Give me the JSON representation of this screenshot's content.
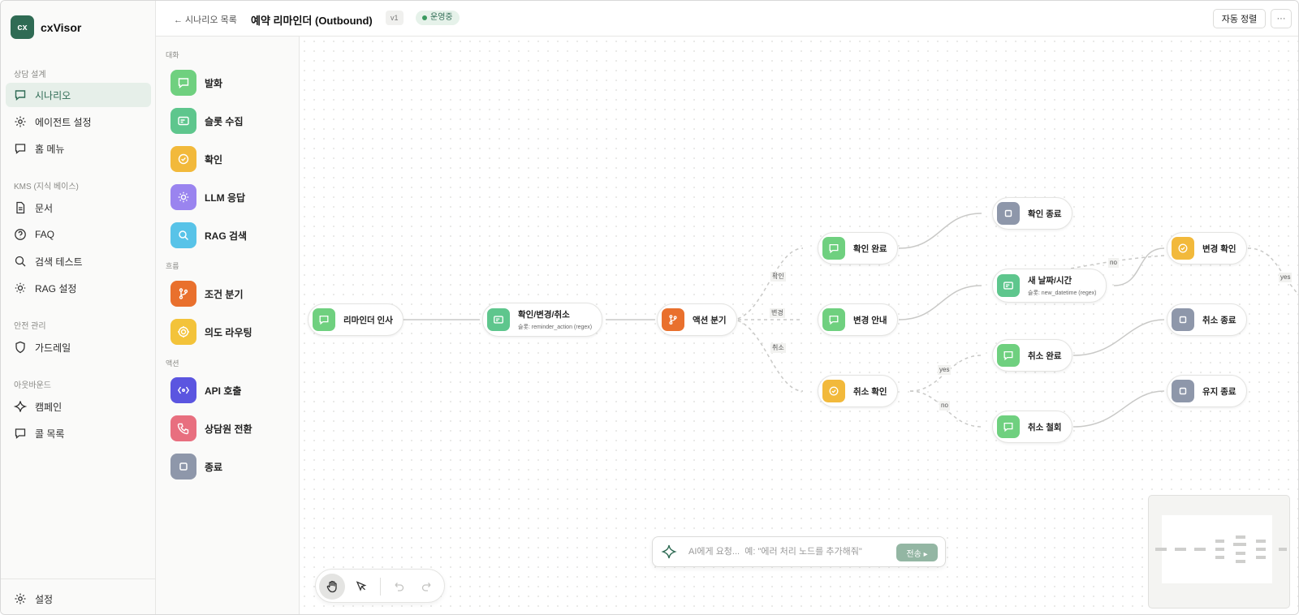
{
  "app": {
    "logo_text": "cx",
    "name": "cxVisor"
  },
  "nav": {
    "sections": [
      {
        "label": "상담 설계",
        "items": [
          {
            "label": "시나리오",
            "icon": "chat-icon",
            "active": true
          },
          {
            "label": "에이전트 설정",
            "icon": "gear-icon"
          },
          {
            "label": "홈 메뉴",
            "icon": "chat-icon"
          }
        ]
      },
      {
        "label": "KMS (지식 베이스)",
        "items": [
          {
            "label": "문서",
            "icon": "document-icon"
          },
          {
            "label": "FAQ",
            "icon": "help-icon"
          },
          {
            "label": "검색 테스트",
            "icon": "search-icon"
          },
          {
            "label": "RAG 설정",
            "icon": "sun-gear-icon"
          }
        ]
      },
      {
        "label": "안전 관리",
        "items": [
          {
            "label": "가드레일",
            "icon": "shield-icon"
          }
        ]
      },
      {
        "label": "아웃바운드",
        "items": [
          {
            "label": "캠페인",
            "icon": "sparkle-icon"
          },
          {
            "label": "콜 목록",
            "icon": "chat-icon"
          }
        ]
      }
    ],
    "footer": {
      "label": "설정",
      "icon": "gear-icon"
    }
  },
  "topbar": {
    "back_label": "← 시나리오 목록",
    "title": "예약 리마인더 (Outbound)",
    "version": "v1",
    "status": "운영중",
    "auto_layout_label": "자동 정렬",
    "more_label": "···"
  },
  "palette": {
    "groups": [
      {
        "label": "대화",
        "items": [
          {
            "label": "발화",
            "icon": "chat-icon",
            "color": "#6fd07f"
          },
          {
            "label": "슬롯 수집",
            "icon": "form-icon",
            "color": "#5ec68d"
          },
          {
            "label": "확인",
            "icon": "check-circle-icon",
            "color": "#f2b93b"
          },
          {
            "label": "LLM 응답",
            "icon": "sun-icon",
            "color": "#9a84ef"
          },
          {
            "label": "RAG 검색",
            "icon": "search-doc-icon",
            "color": "#58c3e8"
          }
        ]
      },
      {
        "label": "흐름",
        "items": [
          {
            "label": "조건 분기",
            "icon": "branch-icon",
            "color": "#e9702d"
          },
          {
            "label": "의도 라우팅",
            "icon": "target-icon",
            "color": "#f3c33a"
          }
        ]
      },
      {
        "label": "액션",
        "items": [
          {
            "label": "API 호출",
            "icon": "api-icon",
            "color": "#5b55e0"
          },
          {
            "label": "상담원 전환",
            "icon": "phone-icon",
            "color": "#e86f7f"
          },
          {
            "label": "종료",
            "icon": "stop-icon",
            "color": "#8e97aa"
          }
        ]
      }
    ]
  },
  "flow": {
    "nodes": [
      {
        "id": "n1",
        "title": "리마인더 인사",
        "icon": "chat-icon",
        "color": "#6fd07f"
      },
      {
        "id": "n2",
        "title": "확인/변경/취소",
        "sub": "슬롯: reminder_action (regex)",
        "icon": "form-icon",
        "color": "#5ec68d"
      },
      {
        "id": "n3",
        "title": "액션 분기",
        "icon": "branch-icon",
        "color": "#e9702d"
      },
      {
        "id": "n4",
        "title": "확인 완료",
        "icon": "chat-icon",
        "color": "#6fd07f"
      },
      {
        "id": "n5",
        "title": "변경 안내",
        "icon": "chat-icon",
        "color": "#6fd07f"
      },
      {
        "id": "n6",
        "title": "취소 확인",
        "icon": "check-circle-icon",
        "color": "#f2b93b"
      },
      {
        "id": "n7",
        "title": "확인 종료",
        "icon": "stop-icon",
        "color": "#8e97aa"
      },
      {
        "id": "n8",
        "title": "새 날짜/시간",
        "sub": "슬롯: new_datetime (regex)",
        "icon": "form-icon",
        "color": "#5ec68d"
      },
      {
        "id": "n9",
        "title": "취소 완료",
        "icon": "chat-icon",
        "color": "#6fd07f"
      },
      {
        "id": "n10",
        "title": "취소 철회",
        "icon": "chat-icon",
        "color": "#6fd07f"
      },
      {
        "id": "n11",
        "title": "변경 확인",
        "icon": "check-circle-icon",
        "color": "#f2b93b"
      },
      {
        "id": "n12",
        "title": "취소 종료",
        "icon": "stop-icon",
        "color": "#8e97aa"
      },
      {
        "id": "n13",
        "title": "유지 종료",
        "icon": "stop-icon",
        "color": "#8e97aa"
      }
    ],
    "edge_labels": [
      "확인",
      "변경",
      "취소",
      "yes",
      "no",
      "no",
      "yes"
    ]
  },
  "ai": {
    "placeholder": "AI에게 요청...  예: \"에러 처리 노드를 추가해줘\"",
    "send_label": "전송 ▸"
  },
  "toolbar": {
    "tools": [
      "hand-icon",
      "pointer-icon",
      "undo-icon",
      "redo-icon"
    ]
  }
}
